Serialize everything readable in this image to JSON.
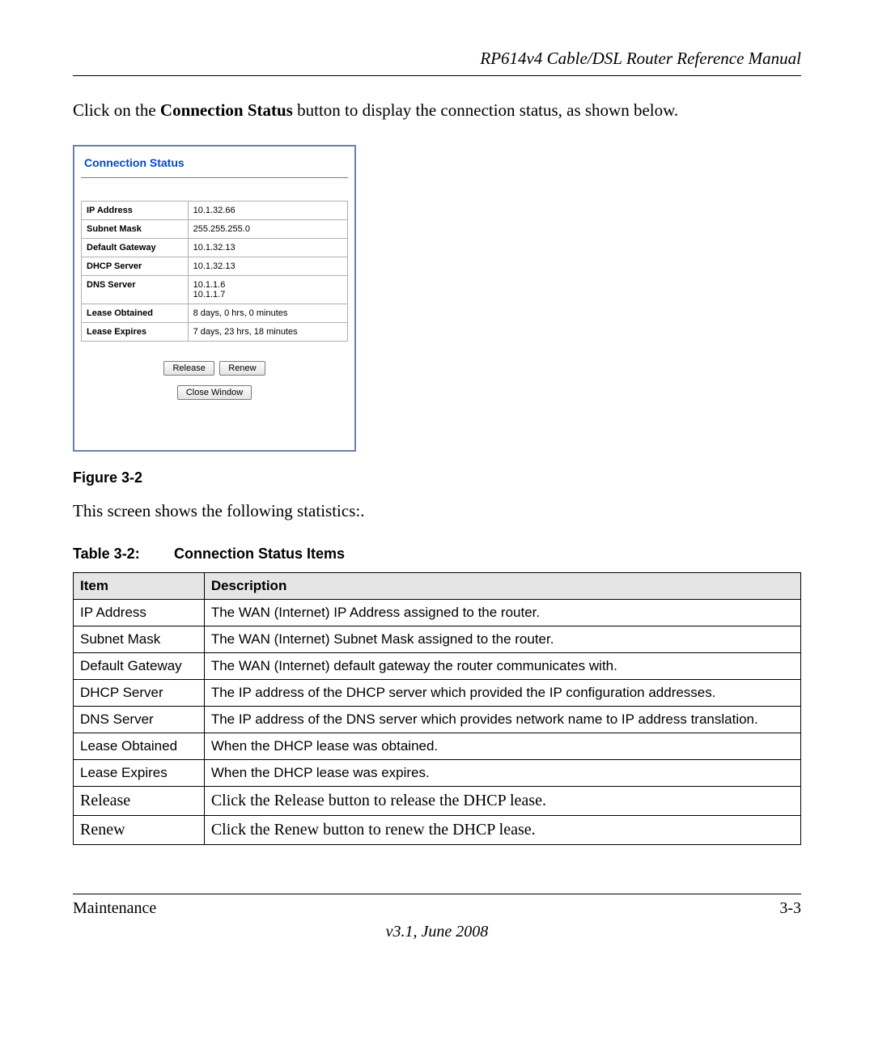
{
  "header": {
    "title": "RP614v4 Cable/DSL Router Reference Manual"
  },
  "intro": {
    "pre": "Click on the ",
    "bold": "Connection Status",
    "post": " button to display the connection status, as shown below."
  },
  "panel": {
    "title": "Connection Status",
    "rows": [
      {
        "label": "IP Address",
        "value": "10.1.32.66"
      },
      {
        "label": "Subnet Mask",
        "value": "255.255.255.0"
      },
      {
        "label": "Default Gateway",
        "value": "10.1.32.13"
      },
      {
        "label": "DHCP Server",
        "value": "10.1.32.13"
      },
      {
        "label": "DNS Server",
        "value": "10.1.1.6\n10.1.1.7"
      },
      {
        "label": "Lease Obtained",
        "value": "8 days, 0 hrs, 0 minutes"
      },
      {
        "label": "Lease Expires",
        "value": "7 days, 23 hrs, 18 minutes"
      }
    ],
    "buttons": {
      "release": "Release",
      "renew": "Renew",
      "close": "Close Window"
    }
  },
  "figure_caption": "Figure 3-2",
  "statistics_text": "This screen shows the following statistics:.",
  "table_caption": {
    "label": "Table 3-2:",
    "title": "Connection Status Items"
  },
  "desc_table": {
    "headers": {
      "item": "Item",
      "desc": "Description"
    },
    "rows": [
      {
        "item": "IP Address",
        "desc": "The WAN (Internet) IP Address assigned to the router.",
        "serif": false
      },
      {
        "item": "Subnet Mask",
        "desc": "The WAN (Internet) Subnet Mask assigned to the router.",
        "serif": false
      },
      {
        "item": "Default Gateway",
        "desc": "The WAN (Internet) default gateway the router communicates with.",
        "serif": false
      },
      {
        "item": "DHCP Server",
        "desc": "The IP address of the DHCP server which provided the IP configuration addresses.",
        "serif": false
      },
      {
        "item": "DNS Server",
        "desc": "The IP address of the DNS server which provides network name to IP address translation.",
        "serif": false
      },
      {
        "item": "Lease Obtained",
        "desc": "When the DHCP lease was obtained.",
        "serif": false
      },
      {
        "item": "Lease Expires",
        "desc": "When the DHCP lease was expires.",
        "serif": false
      },
      {
        "item": "Release",
        "desc": "Click the Release button to release the DHCP lease.",
        "serif": true
      },
      {
        "item": "Renew",
        "desc": "Click the Renew button to renew the DHCP lease.",
        "serif": true
      }
    ]
  },
  "footer": {
    "left": "Maintenance",
    "right": "3-3",
    "center": "v3.1, June 2008"
  }
}
